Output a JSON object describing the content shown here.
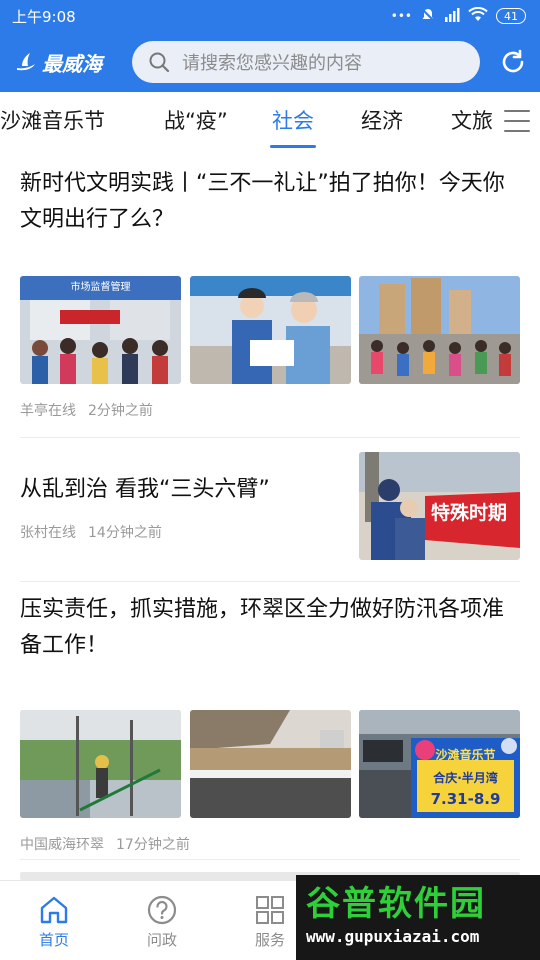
{
  "status_bar": {
    "time": "上午9:08",
    "battery": "41"
  },
  "app": {
    "logo_text": "最威海"
  },
  "search": {
    "placeholder": "请搜索您感兴趣的内容"
  },
  "tabs": [
    {
      "label": "沙滩音乐节",
      "active": false
    },
    {
      "label": "战“疫”",
      "active": false
    },
    {
      "label": "社会",
      "active": true
    },
    {
      "label": "经济",
      "active": false
    },
    {
      "label": "文旅",
      "active": false
    }
  ],
  "articles": [
    {
      "title": "新时代文明实践丨“三不一礼让”拍了拍你！今天你文明出行了么？",
      "source": "羊亭在线",
      "time": "2分钟之前",
      "images": [
        {
          "sign": "市场监督管理"
        },
        {},
        {}
      ]
    },
    {
      "title": "从乱到治 看我“三头六臂”",
      "source": "张村在线",
      "time": "14分钟之前",
      "image_banner": "特殊时期"
    },
    {
      "title": "压实责任，抓实措施，环翠区全力做好防汛各项准备工作！",
      "source": "中国威海环翠",
      "time": "17分钟之前",
      "ad": {
        "title": "沙滩音乐节",
        "line2": "合庆·半月湾",
        "dates": "7.31-8.9"
      }
    }
  ],
  "bottom_nav": [
    {
      "label": "首页",
      "icon": "home-icon",
      "active": true
    },
    {
      "label": "问政",
      "icon": "question-icon",
      "active": false
    },
    {
      "label": "服务",
      "icon": "grid-icon",
      "active": false
    }
  ],
  "watermark": {
    "big": "谷普软件园",
    "small": "www.gupuxiazai.com"
  },
  "colors": {
    "brand_blue": "#2c7be8",
    "meta_gray": "#9a9a9a"
  }
}
